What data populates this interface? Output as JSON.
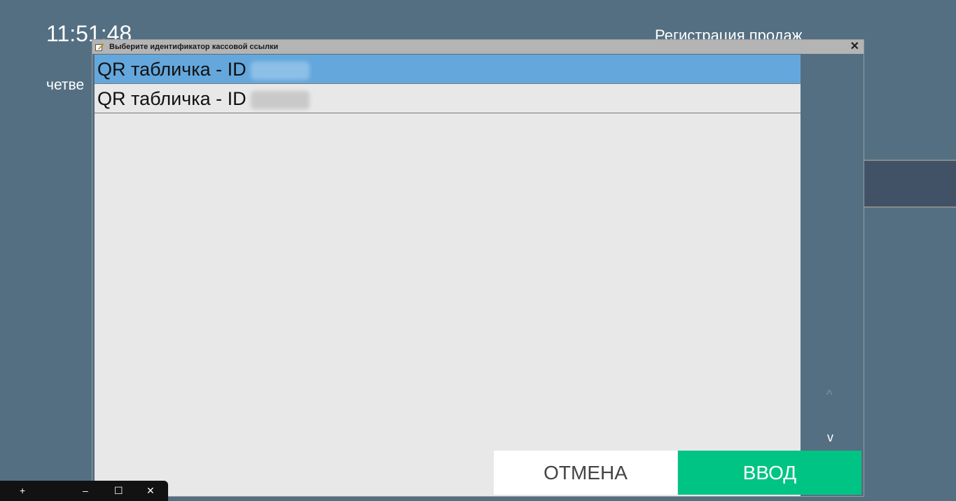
{
  "background": {
    "clock": "11:51:48",
    "day": "четве",
    "title": "Регистрация продаж"
  },
  "dialog": {
    "title": "Выберите идентификатор кассовой ссылки",
    "icon": "window-edit-icon",
    "close_label": "✕",
    "items": [
      {
        "label": "QR табличка - ID",
        "selected": true
      },
      {
        "label": "QR табличка - ID",
        "selected": false
      }
    ],
    "scroll_up": "^",
    "scroll_down": "v",
    "cancel_label": "ОТМЕНА",
    "enter_label": "ВВОД"
  },
  "taskbar": {
    "plus": "+",
    "minimize": "–",
    "maximize": "☐",
    "close": "✕"
  },
  "colors": {
    "background": "#546f82",
    "list_bg": "#e8e8e8",
    "selected_row": "#64a7dc",
    "enter_button": "#00c483",
    "titlebar": "#b4b4b4"
  }
}
